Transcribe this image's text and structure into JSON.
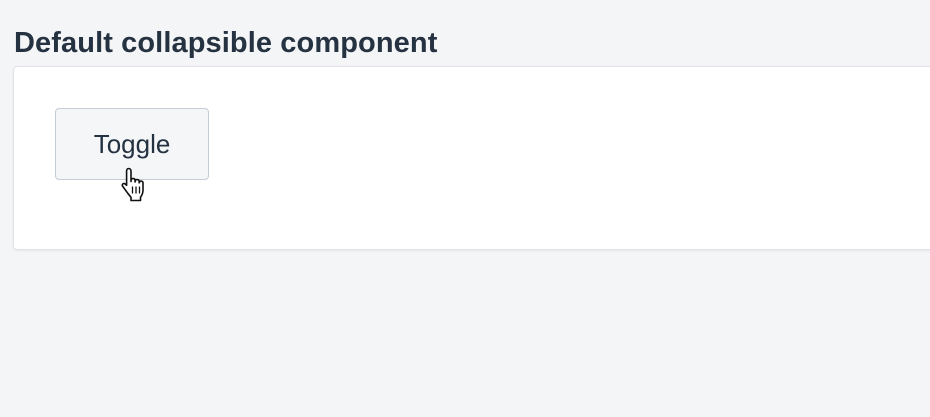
{
  "section": {
    "title": "Default collapsible component"
  },
  "collapsible": {
    "toggle_label": "Toggle"
  },
  "cursor": {
    "icon": "hand-pointer-icon"
  },
  "colors": {
    "background": "#f4f5f7",
    "card": "#ffffff",
    "text": "#253241",
    "button_bg": "#f4f6f8",
    "button_border": "#c4cdd5"
  }
}
